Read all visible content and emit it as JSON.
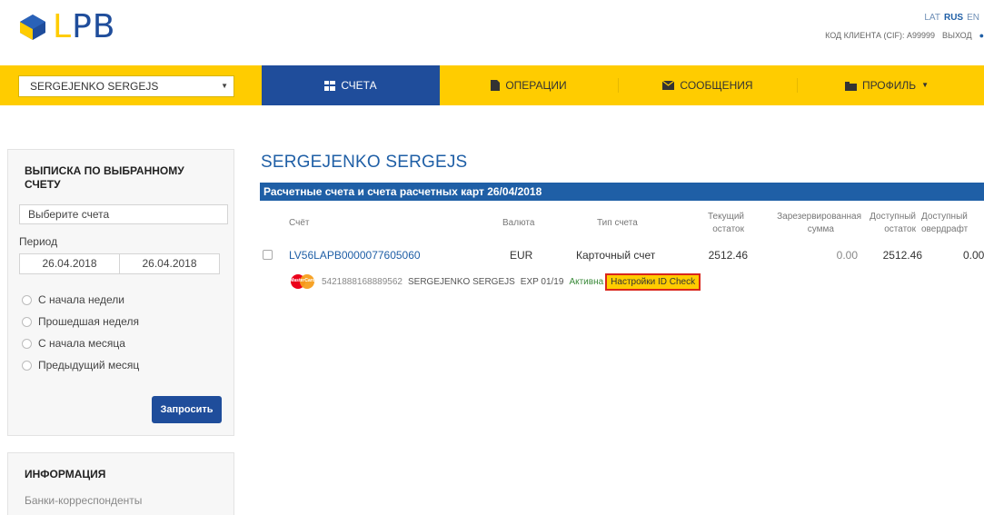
{
  "brand": {
    "logo_text": "LPB",
    "primary_color": "#1f4d9b",
    "accent_color": "#ffcc00"
  },
  "header": {
    "languages": [
      "LAT",
      "RUS",
      "EN"
    ],
    "active_language": "RUS",
    "client_code": "КОД КЛИЕНТА (CIF): A99999",
    "logout_label": "ВЫХОД"
  },
  "nav": {
    "client_select": "SERGEJENKO SERGEJS",
    "tabs": [
      {
        "label": "СЧЕТА",
        "icon": "grid-icon"
      },
      {
        "label": "ОПЕРАЦИИ",
        "icon": "document-icon"
      },
      {
        "label": "СООБЩЕНИЯ",
        "icon": "envelope-icon"
      },
      {
        "label": "ПРОФИЛЬ",
        "icon": "folder-icon"
      }
    ]
  },
  "statement": {
    "title": "ВЫПИСКА ПО ВЫБРАННОМУ СЧЕТУ",
    "account_placeholder": "Выберите счета",
    "period_label": "Период",
    "date_from": "26.04.2018",
    "date_to": "26.04.2018",
    "radios": [
      "С начала недели",
      "Прошедшая неделя",
      "С начала месяца",
      "Предыдущий месяц"
    ],
    "request_button": "Запросить"
  },
  "info": {
    "title": "ИНФОРМАЦИЯ",
    "links": [
      "Банки-корреспонденты"
    ]
  },
  "main": {
    "title": "SERGEJENKO SERGEJS",
    "table_title": "Расчетные счета и счета расчетных карт 26/04/2018",
    "columns": {
      "account": "Счёт",
      "currency": "Валюта",
      "type": "Тип счета",
      "current_1": "Текущий",
      "current_2": "остаток",
      "reserved_1": "Зарезервированная",
      "reserved_2": "сумма",
      "available_1": "Доступный",
      "available_2": "остаток",
      "overdraft_1": "Доступный",
      "overdraft_2": "овердрафт"
    },
    "row": {
      "account": "LV56LAPB0000077605060",
      "currency": "EUR",
      "type": "Карточный счет",
      "current": "2512.46",
      "reserved": "0.00",
      "available": "2512.46",
      "overdraft": "0.00"
    },
    "card": {
      "brand_text": "MasterCard",
      "number": "5421888168889562",
      "holder": "SERGEJENKO SERGEJS",
      "expiry": "EXP 01/19",
      "status": "Активна",
      "id_check_button": "Настройки ID Check"
    }
  }
}
